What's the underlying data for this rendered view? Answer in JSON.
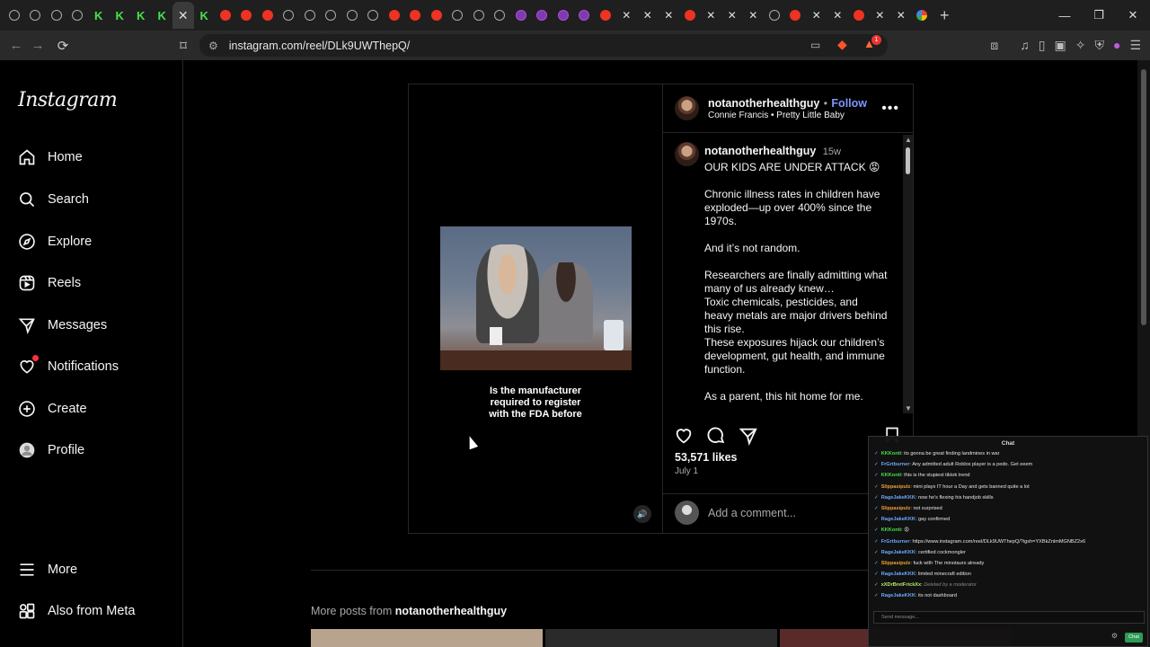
{
  "browser": {
    "tabs": [
      {
        "icon": "generic"
      },
      {
        "icon": "generic"
      },
      {
        "icon": "generic"
      },
      {
        "icon": "generic"
      },
      {
        "icon": "kick"
      },
      {
        "icon": "kick"
      },
      {
        "icon": "kick"
      },
      {
        "icon": "kick"
      },
      {
        "icon": "active"
      },
      {
        "icon": "kick"
      },
      {
        "icon": "youtube"
      },
      {
        "icon": "red"
      },
      {
        "icon": "red"
      },
      {
        "icon": "generic"
      },
      {
        "icon": "generic"
      },
      {
        "icon": "generic"
      },
      {
        "icon": "generic"
      },
      {
        "icon": "generic"
      },
      {
        "icon": "red"
      },
      {
        "icon": "red"
      },
      {
        "icon": "red"
      },
      {
        "icon": "generic"
      },
      {
        "icon": "generic"
      },
      {
        "icon": "generic"
      },
      {
        "icon": "purple"
      },
      {
        "icon": "purple"
      },
      {
        "icon": "purple"
      },
      {
        "icon": "purple"
      },
      {
        "icon": "red"
      },
      {
        "icon": "x"
      },
      {
        "icon": "x"
      },
      {
        "icon": "x"
      },
      {
        "icon": "youtube"
      },
      {
        "icon": "x"
      },
      {
        "icon": "x"
      },
      {
        "icon": "x"
      },
      {
        "icon": "generic"
      },
      {
        "icon": "red"
      },
      {
        "icon": "x"
      },
      {
        "icon": "x"
      },
      {
        "icon": "red"
      },
      {
        "icon": "x"
      },
      {
        "icon": "x"
      },
      {
        "icon": "google"
      }
    ],
    "active_tab_close": "✕",
    "new_tab": "+",
    "url": "instagram.com/reel/DLk9UWThepQ/",
    "brave_badge": "1"
  },
  "ig": {
    "logo": "Instagram",
    "nav": [
      {
        "label": "Home",
        "icon": "home-icon"
      },
      {
        "label": "Search",
        "icon": "search-icon"
      },
      {
        "label": "Explore",
        "icon": "compass-icon"
      },
      {
        "label": "Reels",
        "icon": "reels-icon"
      },
      {
        "label": "Messages",
        "icon": "messenger-icon"
      },
      {
        "label": "Notifications",
        "icon": "heart-icon"
      },
      {
        "label": "Create",
        "icon": "plus-square-icon"
      },
      {
        "label": "Profile",
        "icon": "profile-avatar"
      }
    ],
    "more": "More",
    "also_from_meta": "Also from Meta"
  },
  "post": {
    "video_caption": "Is the manufacturer required to register with the FDA before",
    "username": "notanotherhealthguy",
    "separator": "•",
    "follow": "Follow",
    "audio": "Connie Francis • Pretty Little Baby",
    "comment_user": "notanotherhealthguy",
    "comment_age": "15w",
    "paragraphs": [
      "OUR KIDS ARE UNDER ATTACK 😡",
      "Chronic illness rates in children have exploded—up over 400% since the 1970s.",
      "And it’s not random.",
      "Researchers are finally admitting what many of us already knew…\nToxic chemicals, pesticides, and heavy metals are major drivers behind this rise.\nThese exposures hijack our children’s development, gut health, and immune function.",
      "As a parent, this hit home for me."
    ],
    "likes": "53,571 likes",
    "date": "July 1",
    "comment_placeholder": "Add a comment..."
  },
  "more_posts": {
    "prefix": "More posts from",
    "user": "notanotherhealthguy"
  },
  "chat": {
    "title": "Chat",
    "messages": [
      {
        "user": "KKKonti",
        "color": "#45e24a",
        "text": "its gonna be great finding landmines in war"
      },
      {
        "user": "FrGrtburner",
        "color": "#6aa9ff",
        "text": "Any admitted adult Roblox player is a pedo. Get eeem"
      },
      {
        "user": "KKKonti",
        "color": "#45e24a",
        "text": "this is the stupiest tiktok trend"
      },
      {
        "user": "Slippasipulz",
        "color": "#f0a030",
        "text": "mini plays IT hour a Day and gets banned quite a lot"
      },
      {
        "user": "RageJakeKKK",
        "color": "#6aa9ff",
        "text": "now he's flexing his handjob skills"
      },
      {
        "user": "Slippasipulz",
        "color": "#f0a030",
        "text": "not surprised"
      },
      {
        "user": "RageJakeKKK",
        "color": "#6aa9ff",
        "text": "gay confirmed"
      },
      {
        "user": "KKKonti",
        "color": "#45e24a",
        "text": "😡"
      },
      {
        "user": "FrGrtburner",
        "color": "#6aa9ff",
        "text": "https://www.instagram.com/reel/DLk9UWThepQ/?igsh=YXBkZnlmMGNBZ2x6"
      },
      {
        "user": "RageJakeKKK",
        "color": "#6aa9ff",
        "text": "certified cockmongler"
      },
      {
        "user": "Slippasipulz",
        "color": "#f0a030",
        "text": "fuck with The minotaurs already"
      },
      {
        "user": "RageJakeKKK",
        "color": "#6aa9ff",
        "text": "limited minecraft edition"
      },
      {
        "user": "xXDrBretFrickXx",
        "color": "#b5e86a",
        "text": "Deleted by a moderator"
      },
      {
        "user": "RageJakeKKK",
        "color": "#6aa9ff",
        "text": "its not dashboard"
      }
    ],
    "send_placeholder": "Send message...",
    "chat_button": "Chat"
  }
}
